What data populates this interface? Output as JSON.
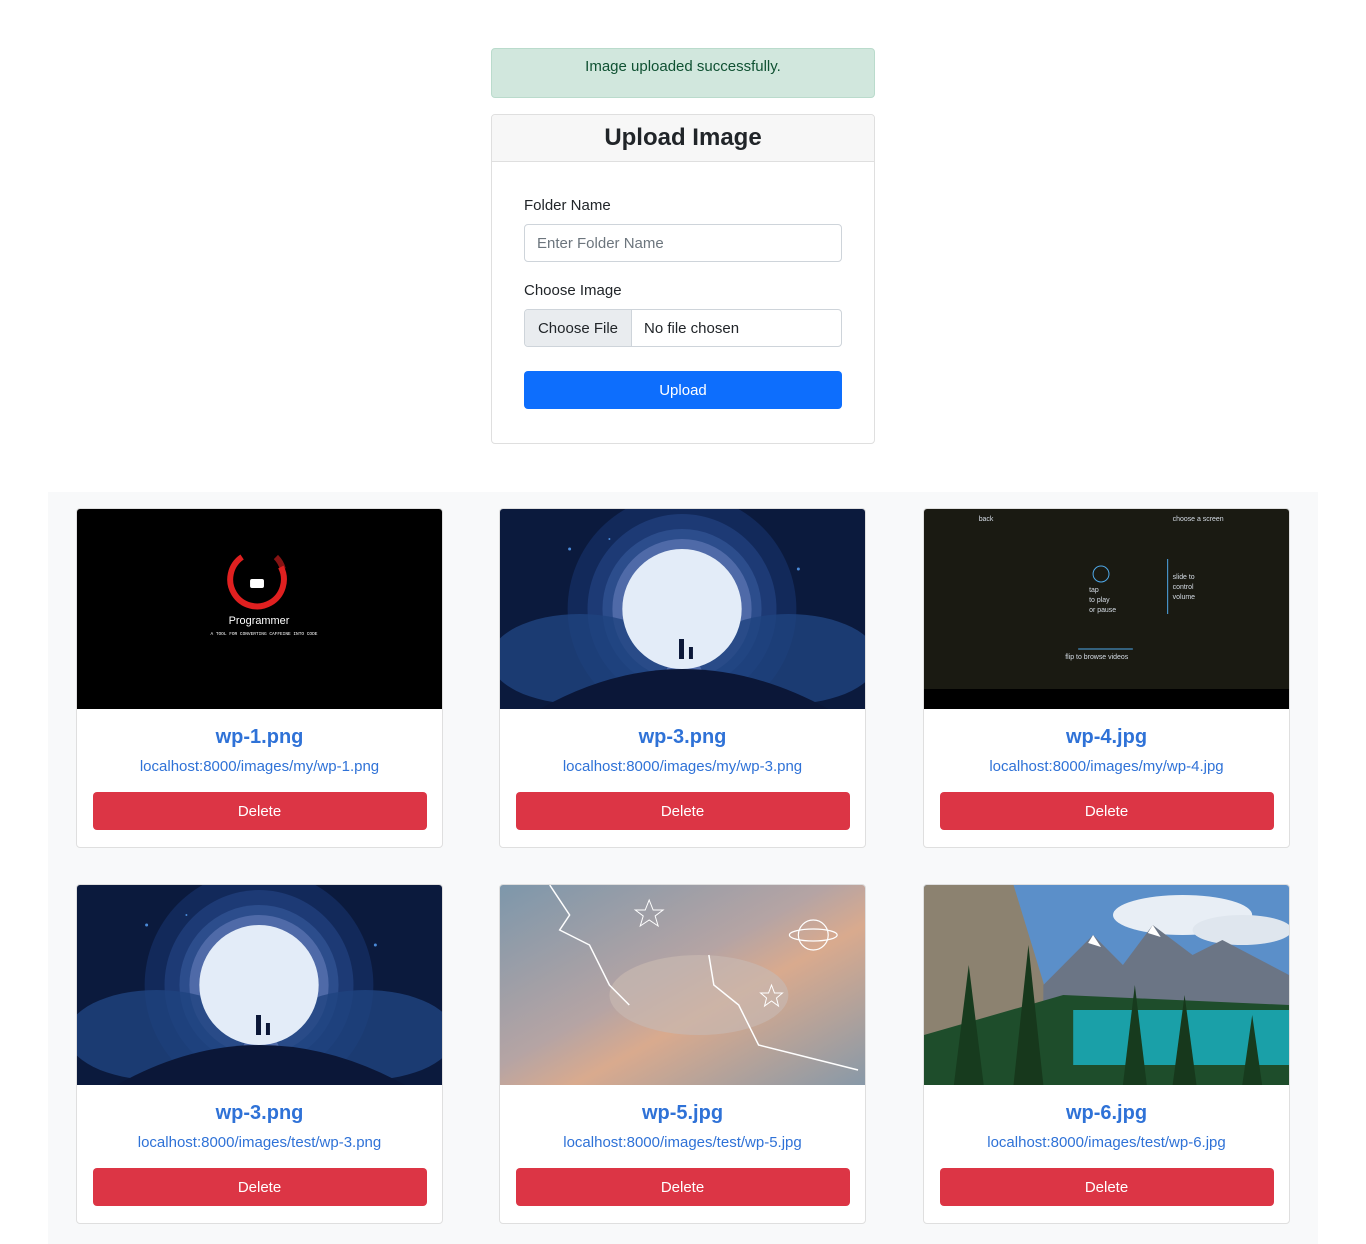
{
  "alert": {
    "message": "Image uploaded successfully."
  },
  "upload_form": {
    "title": "Upload Image",
    "folder_label": "Folder Name",
    "folder_placeholder": "Enter Folder Name",
    "folder_value": "",
    "image_label": "Choose Image",
    "file_button_label": "Choose File",
    "file_status": "No file chosen",
    "submit_label": "Upload"
  },
  "gallery": {
    "items": [
      {
        "title": "wp-1.png",
        "url": "localhost:8000/images/my/wp-1.png",
        "delete_label": "Delete",
        "image": "programmer-wallpaper",
        "img_text": {
          "headline": "Programmer",
          "tagline": "A TOOL FOR CONVERTING CAFFEINE INTO CODE"
        }
      },
      {
        "title": "wp-3.png",
        "url": "localhost:8000/images/my/wp-3.png",
        "delete_label": "Delete",
        "image": "moon-silhouette-wallpaper"
      },
      {
        "title": "wp-4.jpg",
        "url": "localhost:8000/images/my/wp-4.jpg",
        "delete_label": "Delete",
        "image": "chalkboard-instructions-wallpaper",
        "img_text": {
          "back": "back",
          "choose": "choose a screen",
          "tap": "tap",
          "to_play": "to play",
          "or_pause": "or pause",
          "slide": "slide to",
          "control": "control",
          "volume": "volume",
          "flip": "flip to browse videos"
        }
      },
      {
        "title": "wp-3.png",
        "url": "localhost:8000/images/test/wp-3.png",
        "delete_label": "Delete",
        "image": "moon-silhouette-wallpaper"
      },
      {
        "title": "wp-5.jpg",
        "url": "localhost:8000/images/test/wp-5.jpg",
        "delete_label": "Delete",
        "image": "doodled-cloudy-sky-photo"
      },
      {
        "title": "wp-6.jpg",
        "url": "localhost:8000/images/test/wp-6.jpg",
        "delete_label": "Delete",
        "image": "mountain-lake-photo"
      }
    ]
  },
  "colors": {
    "primary": "#0d6efd",
    "danger": "#dc3545",
    "link": "#2f72d7",
    "success_bg": "#d1e7dd",
    "success_text": "#0f5132"
  }
}
